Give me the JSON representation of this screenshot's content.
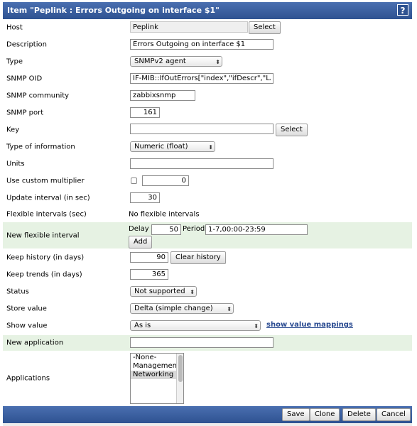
{
  "header": {
    "title": "Item \"Peplink : Errors Outgoing on interface $1\"",
    "help_icon": "?"
  },
  "form": {
    "host": {
      "label": "Host",
      "value": "Peplink",
      "button": "Select"
    },
    "description": {
      "label": "Description",
      "value": "Errors Outgoing on interface $1"
    },
    "type": {
      "label": "Type",
      "selected": "SNMPv2 agent"
    },
    "snmp_oid": {
      "label": "SNMP OID",
      "value": "IF-MIB::IfOutErrors[\"index\",\"ifDescr\",\"LAN\"]"
    },
    "snmp_community": {
      "label": "SNMP community",
      "value": "zabbixsnmp"
    },
    "snmp_port": {
      "label": "SNMP port",
      "value": "161"
    },
    "key": {
      "label": "Key",
      "value": "",
      "button": "Select"
    },
    "type_of_information": {
      "label": "Type of information",
      "selected": "Numeric (float)"
    },
    "units": {
      "label": "Units",
      "value": ""
    },
    "custom_multiplier": {
      "label": "Use custom multiplier",
      "checked": false,
      "value": "0"
    },
    "update_interval": {
      "label": "Update interval (in sec)",
      "value": "30"
    },
    "flexible_intervals": {
      "label": "Flexible intervals (sec)",
      "value": "No flexible intervals"
    },
    "new_flexible_interval": {
      "label": "New flexible interval",
      "delay_label": "Delay",
      "delay_value": "50",
      "period_label": "Period",
      "period_value": "1-7,00:00-23:59",
      "add_button": "Add"
    },
    "keep_history": {
      "label": "Keep history (in days)",
      "value": "90",
      "button": "Clear history"
    },
    "keep_trends": {
      "label": "Keep trends (in days)",
      "value": "365"
    },
    "status": {
      "label": "Status",
      "selected": "Not supported"
    },
    "store_value": {
      "label": "Store value",
      "selected": "Delta (simple change)"
    },
    "show_value": {
      "label": "Show value",
      "selected": "As is",
      "link": "show value mappings"
    },
    "new_application": {
      "label": "New application",
      "value": ""
    },
    "applications": {
      "label": "Applications",
      "options": [
        "-None-",
        "Management",
        "Networking"
      ],
      "selected_index": 2
    }
  },
  "footer": {
    "save": "Save",
    "clone": "Clone",
    "delete": "Delete",
    "cancel": "Cancel"
  }
}
